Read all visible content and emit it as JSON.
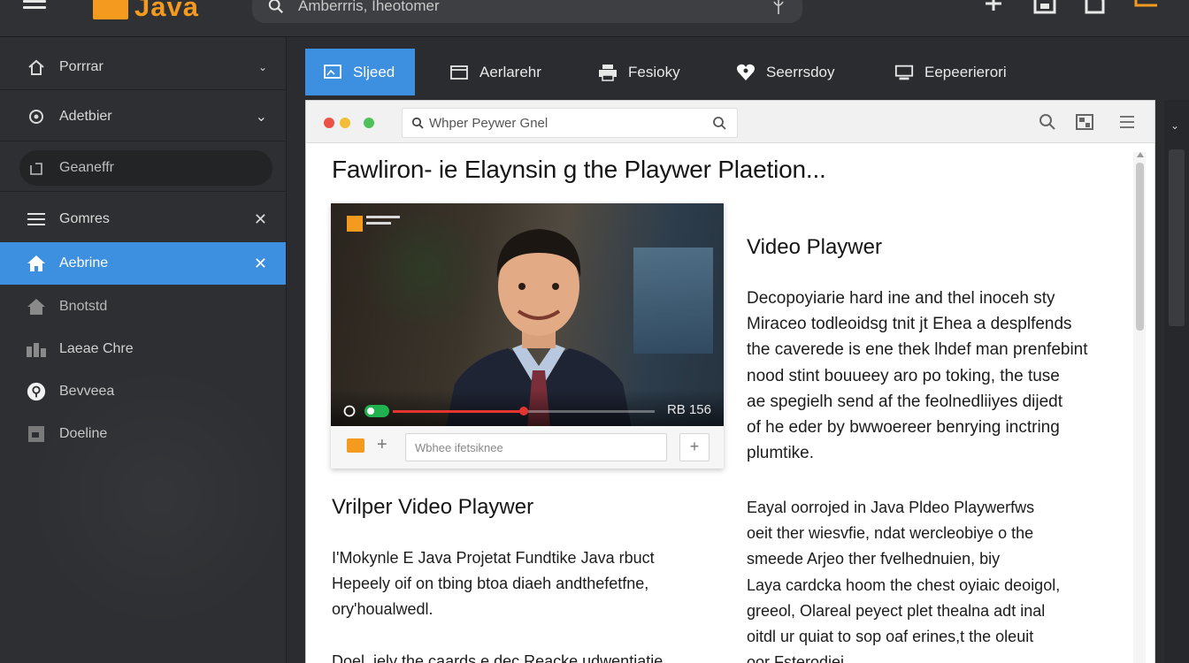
{
  "topbar": {
    "brand": "Java",
    "search_text": "Amberrris, Iheotomer"
  },
  "sidebar": {
    "items": [
      {
        "label": "Porrrar",
        "icon": "home-icon",
        "right": "chevron-down"
      },
      {
        "label": "Adetbier",
        "icon": "settings-icon",
        "right": "chevron-down"
      },
      {
        "label": "Geaneffr",
        "icon": "square-icon",
        "right": ""
      },
      {
        "label": "Gomres",
        "icon": "menu-icon",
        "right": "✕"
      },
      {
        "label": "Aebrine",
        "icon": "home-icon",
        "right": "✕",
        "active": true
      },
      {
        "label": "Bnotstd",
        "icon": "home-icon",
        "right": ""
      },
      {
        "label": "Laeae Chre",
        "icon": "grid-icon",
        "right": ""
      },
      {
        "label": "Bevveea",
        "icon": "question-icon",
        "right": ""
      },
      {
        "label": "Doeline",
        "icon": "doc-icon",
        "right": ""
      }
    ]
  },
  "tabs": [
    {
      "label": "Sljeed",
      "icon": "image-icon",
      "active": true
    },
    {
      "label": "Aerlarehr",
      "icon": "window-icon"
    },
    {
      "label": "Fesioky",
      "icon": "printer-icon"
    },
    {
      "label": "Seerrsdoy",
      "icon": "heart-icon"
    },
    {
      "label": "Eepeerierori",
      "icon": "monitor-icon"
    }
  ],
  "browser": {
    "url_text": "Whper Peywer Gnel",
    "title": "Fawliron- ie Elaynsin g the Playwer Plaetion...",
    "video": {
      "time": "RB 156",
      "progress": 0.5,
      "input_placeholder": "Wbhee ifetsiknee",
      "add_label": "+"
    },
    "section_right": {
      "heading": "Video Playwer",
      "paragraph": [
        "Decopoyiarie hard ine and thel inoceh sty",
        "Miraceo todleoidsg tnit jt Ehea a desplfends",
        "the caverede is ene thek lhdef man prenfebint",
        "nood stint bouueey aro po toking, the tuse",
        "ae spegielh send af the feolnedliiyes dijedt",
        "of he eder by bwwoereer benrying inctring",
        "plumtike."
      ]
    },
    "section_left": {
      "heading": "Vrilper Video Playwer",
      "paragraph": [
        "I'Mokynle E Java Projetat Fundtike Java rbuct",
        "Hepeely oif on tbing btoa diaeh andthefetfne,",
        "ory'houalwedl."
      ],
      "cut_line": "Doel, iely the caards  e dec Reacke udwentiatie"
    },
    "section_right2": {
      "paragraph": [
        "Eayal oorrojed in Java Pldeo Playwerfws",
        "oeit ther wiesvfie, ndat wercleobiye  o the",
        "smeede Arjeo ther fvelhednuien, biy",
        "Laya cardcka hoom the chest oyiaic deoigol,",
        "greeol, Olareal peyect plet thealna adt inal",
        "oitdl ur quiat to sop oaf erines,t the oleuit",
        "oor Fsterodiei"
      ]
    }
  }
}
